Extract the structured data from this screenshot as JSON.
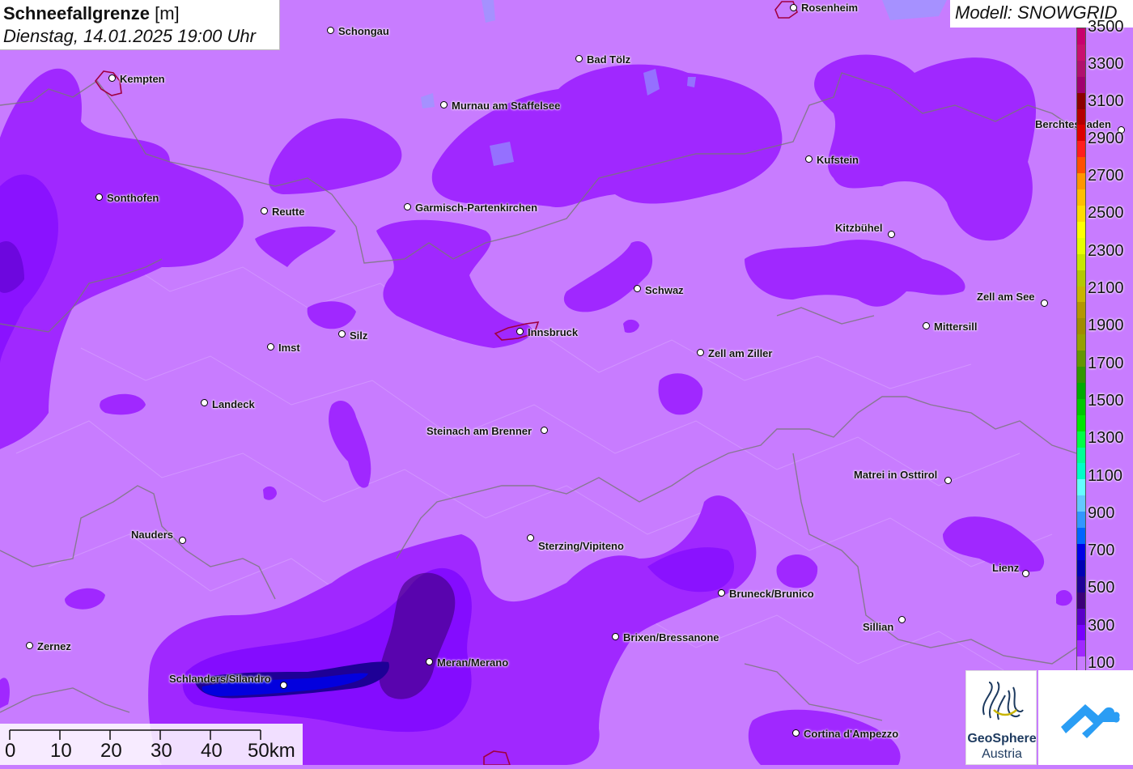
{
  "title": {
    "main": "Schneefallgrenze",
    "unit": "[m]",
    "datetime": "Dienstag, 14.01.2025 19:00 Uhr"
  },
  "model": "Modell: SNOWGRID",
  "cities": [
    {
      "name": "Rosenheim"
    },
    {
      "name": "Schongau"
    },
    {
      "name": "Bad Tölz"
    },
    {
      "name": "Kempten"
    },
    {
      "name": "Murnau am Staffelsee"
    },
    {
      "name": "Berchtesgaden"
    },
    {
      "name": "Kufstein"
    },
    {
      "name": "Sonthofen"
    },
    {
      "name": "Reutte"
    },
    {
      "name": "Garmisch-Partenkirchen"
    },
    {
      "name": "Kitzbühel"
    },
    {
      "name": "Schwaz"
    },
    {
      "name": "Zell am See"
    },
    {
      "name": "Innsbruck"
    },
    {
      "name": "Silz"
    },
    {
      "name": "Mittersill"
    },
    {
      "name": "Imst"
    },
    {
      "name": "Zell am Ziller"
    },
    {
      "name": "Landeck"
    },
    {
      "name": "Steinach am Brenner"
    },
    {
      "name": "Matrei in Osttirol"
    },
    {
      "name": "Nauders"
    },
    {
      "name": "Sterzing/Vipiteno"
    },
    {
      "name": "Lienz"
    },
    {
      "name": "Bruneck/Brunico"
    },
    {
      "name": "Sillian"
    },
    {
      "name": "Brixen/Bressanone"
    },
    {
      "name": "Zernez"
    },
    {
      "name": "Meran/Merano"
    },
    {
      "name": "Schlanders/Silandro"
    },
    {
      "name": "Cortina d'Ampezzo"
    }
  ],
  "legend": {
    "labels": [
      "3500",
      "3300",
      "3100",
      "2900",
      "2700",
      "2500",
      "2300",
      "2100",
      "1900",
      "1700",
      "1500",
      "1300",
      "1100",
      "900",
      "700",
      "500",
      "300",
      "100"
    ],
    "colors": [
      "#c8006e",
      "#c8106e",
      "#b0106e",
      "#a0006e",
      "#8c0000",
      "#b40000",
      "#dc0000",
      "#ff1e1e",
      "#ff5000",
      "#ff9600",
      "#ffbe00",
      "#ffdc00",
      "#ffff00",
      "#e6ff00",
      "#c8e600",
      "#b4c800",
      "#c8b400",
      "#b49600",
      "#a08c00",
      "#96a000",
      "#649600",
      "#329600",
      "#00aa00",
      "#00c800",
      "#00e600",
      "#00ff46",
      "#00ff96",
      "#00ffc8",
      "#64ffff",
      "#64c8ff",
      "#3296ff",
      "#0064ff",
      "#0000e6",
      "#0000b4",
      "#1e0096",
      "#3c0078",
      "#5a00c8",
      "#7800ff",
      "#a028ff",
      "#c87cff"
    ]
  },
  "scale": {
    "labels": [
      "0",
      "10",
      "20",
      "30",
      "40",
      "50km"
    ]
  },
  "logos": {
    "geosphere_name": "GeoSphere",
    "geosphere_sub": "Austria"
  },
  "colors": {
    "base": "#c87cff",
    "purple_mid": "#a028ff",
    "purple_dark": "#7800ff",
    "blue_dark": "#3c0078",
    "blue": "#0000e6"
  }
}
